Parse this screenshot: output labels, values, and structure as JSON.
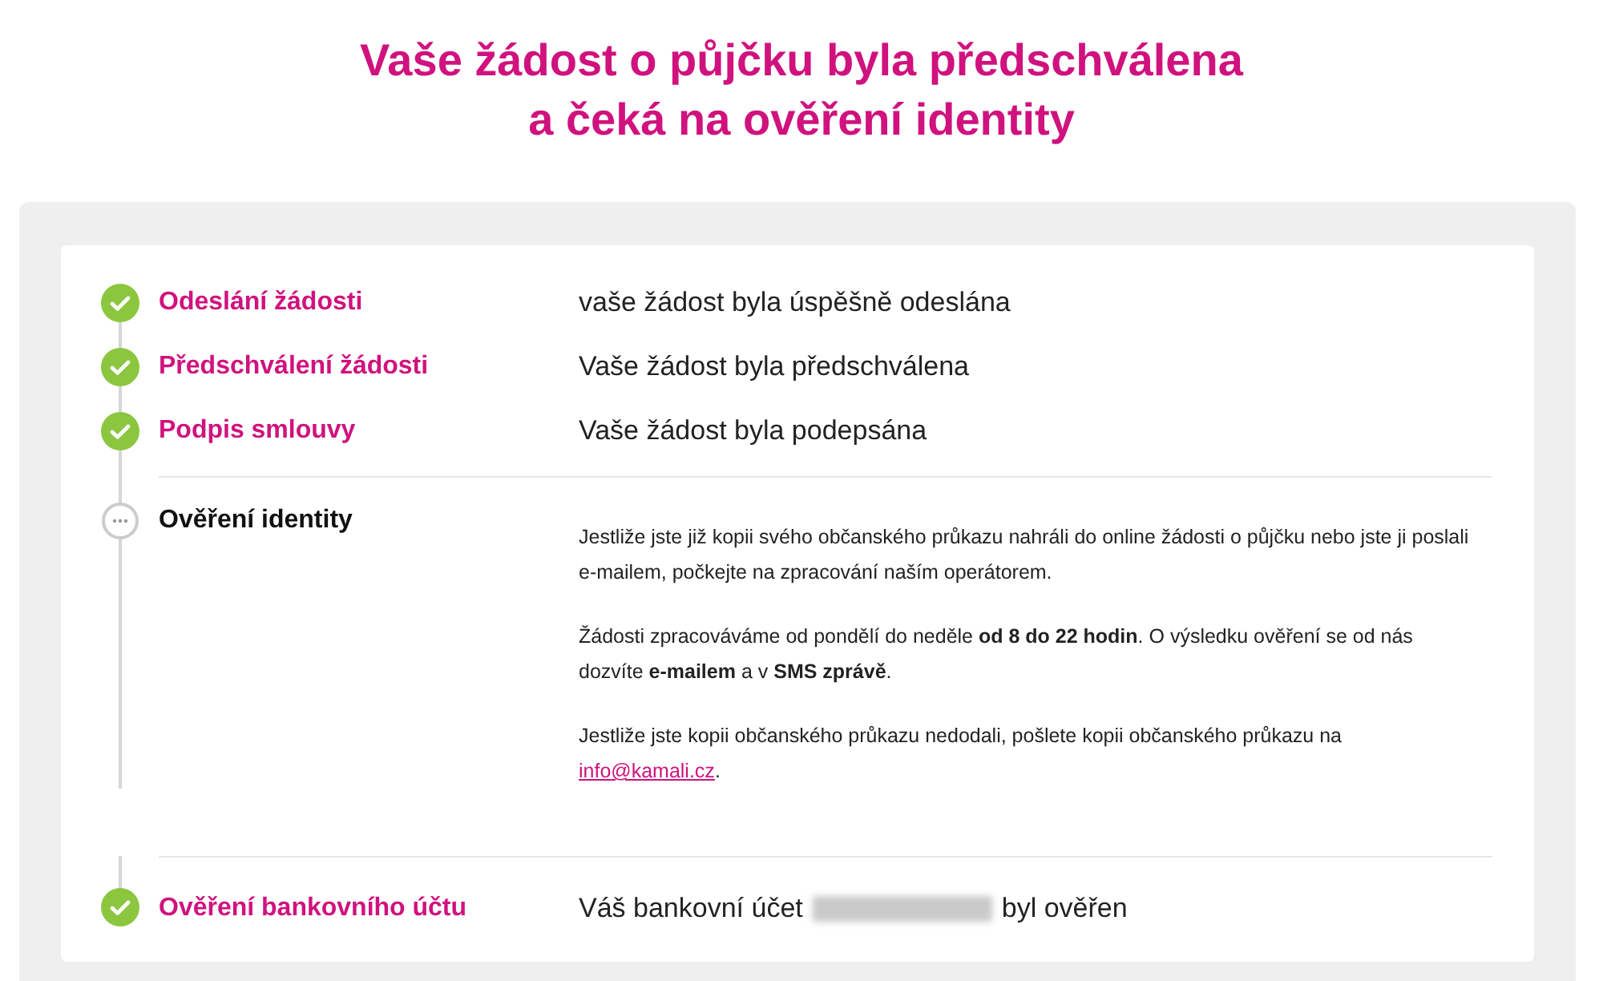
{
  "title_lines": [
    "Vaše žádost o půjčku byla předschválena",
    "a čeká na ověření identity"
  ],
  "steps": [
    {
      "kind": "done",
      "label": "Odeslání žádosti",
      "message": "vaše žádost byla úspěšně odeslána"
    },
    {
      "kind": "done",
      "label": "Předschválení žádosti",
      "message": "Vaše žádost byla předschválena"
    },
    {
      "kind": "done",
      "label": "Podpis smlouvy",
      "message": "Vaše žádost byla podepsána"
    },
    {
      "kind": "pending",
      "label": "Ověření identity",
      "paragraphs": [
        {
          "text": "Jestliže jste již kopii svého občanského průkazu nahráli do online žádosti o půjčku nebo jste ji poslali e-mailem, počkejte na zpracování naším operátorem."
        },
        {
          "text": "Žádosti zpracováváme od pondělí do neděle **od 8 do 22 hodin**. O výsledku ověření se od nás dozvíte **e-mailem** a v **SMS zprávě**."
        },
        {
          "text": "Jestliže jste kopii občanského průkazu nedodali, pošlete kopii občanského průkazu na",
          "link": "info@kamali.cz",
          "after": "."
        }
      ]
    },
    {
      "kind": "done",
      "label": "Ověření bankovního účtu",
      "message": "Váš bankovní účet",
      "redacted": true,
      "message_after": "byl ověřen"
    }
  ]
}
